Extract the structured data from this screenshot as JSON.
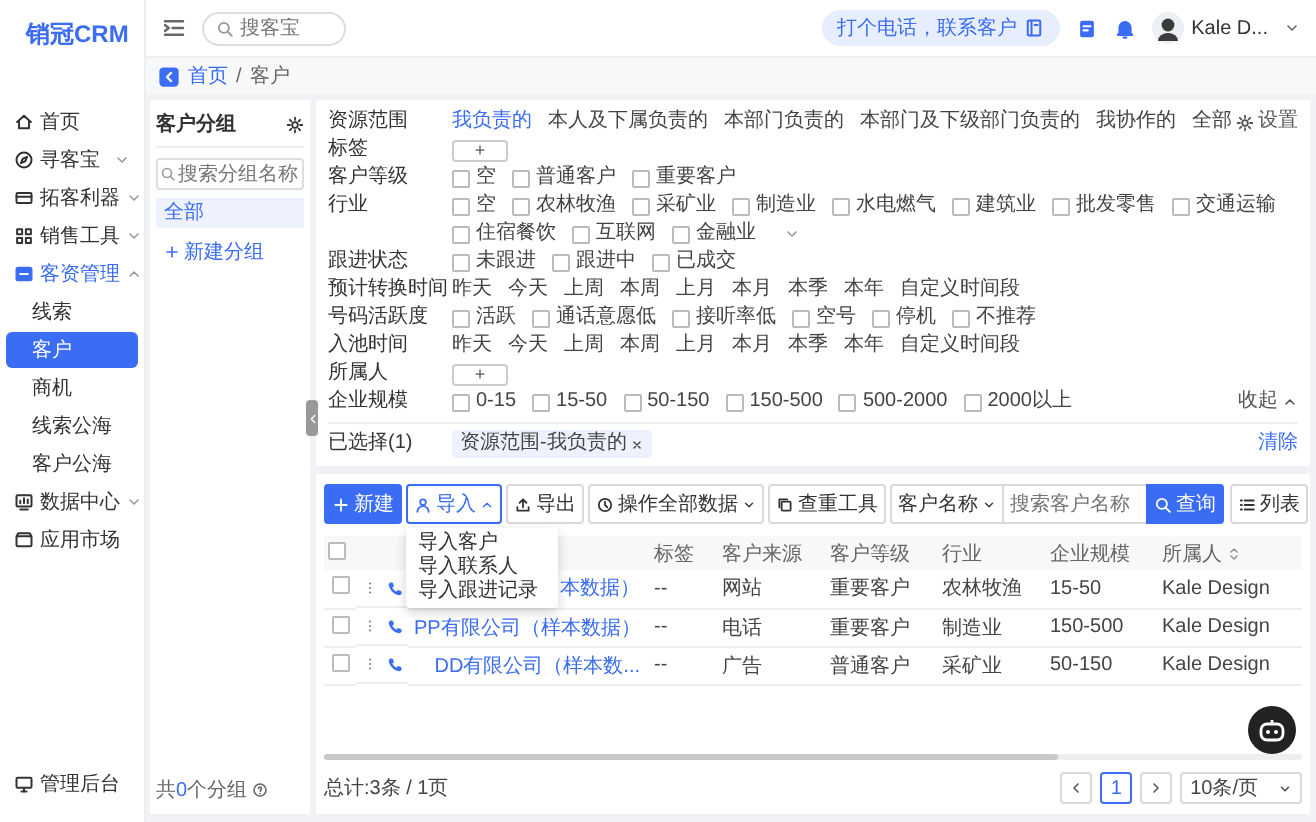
{
  "logo": {
    "text": "销冠CRM"
  },
  "topbar": {
    "search_placeholder": "搜客宝",
    "call_button": "打个电话，联系客户",
    "user": "Kale D..."
  },
  "breadcrumb": {
    "items": [
      "首页",
      "客户"
    ],
    "separator": "/"
  },
  "sidebar": {
    "items": [
      {
        "label": "首页",
        "kind": "link",
        "selected": false
      },
      {
        "label": "寻客宝",
        "kind": "group",
        "expanded": false,
        "selected": false
      },
      {
        "label": "拓客利器",
        "kind": "group",
        "expanded": false,
        "selected": false
      },
      {
        "label": "销售工具",
        "kind": "group",
        "expanded": false,
        "selected": false
      },
      {
        "label": "客资管理",
        "kind": "group",
        "expanded": true,
        "selected": false,
        "children": [
          {
            "label": "线索",
            "selected": false
          },
          {
            "label": "客户",
            "selected": true
          },
          {
            "label": "商机",
            "selected": false
          },
          {
            "label": "线索公海",
            "selected": false
          },
          {
            "label": "客户公海",
            "selected": false
          }
        ]
      },
      {
        "label": "数据中心",
        "kind": "group",
        "expanded": false,
        "selected": false
      },
      {
        "label": "应用市场",
        "kind": "link",
        "selected": false
      }
    ],
    "footer": "管理后台"
  },
  "groups": {
    "title": "客户分组",
    "search_placeholder": "搜索分组名称",
    "items": [
      {
        "label": "全部",
        "selected": true
      }
    ],
    "add_label": "新建分组",
    "count_prefix": "共",
    "count": "0",
    "count_suffix": "个分组"
  },
  "filters": {
    "rows": [
      {
        "label": "资源范围",
        "kind": "links",
        "options": [
          {
            "label": "我负责的",
            "selected": true
          },
          {
            "label": "本人及下属负责的",
            "selected": false
          },
          {
            "label": "本部门负责的",
            "selected": false
          },
          {
            "label": "本部门及下级部门负责的",
            "selected": false
          },
          {
            "label": "我协作的",
            "selected": false
          },
          {
            "label": "全部",
            "selected": false
          }
        ],
        "action": {
          "kind": "settings",
          "label": "设置"
        }
      },
      {
        "label": "标签",
        "kind": "add",
        "button": "+"
      },
      {
        "label": "客户等级",
        "kind": "checks",
        "options": [
          {
            "label": "空",
            "checked": false
          },
          {
            "label": "普通客户",
            "checked": false
          },
          {
            "label": "重要客户",
            "checked": false
          }
        ]
      },
      {
        "label": "行业",
        "kind": "checks",
        "expanded": false,
        "options": [
          {
            "label": "空",
            "checked": false
          },
          {
            "label": "农林牧渔",
            "checked": false
          },
          {
            "label": "采矿业",
            "checked": false
          },
          {
            "label": "制造业",
            "checked": false
          },
          {
            "label": "水电燃气",
            "checked": false
          },
          {
            "label": "建筑业",
            "checked": false
          },
          {
            "label": "批发零售",
            "checked": false
          },
          {
            "label": "交通运输",
            "checked": false
          },
          {
            "label": "住宿餐饮",
            "checked": false
          },
          {
            "label": "互联网",
            "checked": false
          },
          {
            "label": "金融业",
            "checked": false
          }
        ]
      },
      {
        "label": "跟进状态",
        "kind": "checks",
        "options": [
          {
            "label": "未跟进",
            "checked": false
          },
          {
            "label": "跟进中",
            "checked": false
          },
          {
            "label": "已成交",
            "checked": false
          }
        ]
      },
      {
        "label": "预计转换时间",
        "kind": "links",
        "options": [
          {
            "label": "昨天",
            "selected": false
          },
          {
            "label": "今天",
            "selected": false
          },
          {
            "label": "上周",
            "selected": false
          },
          {
            "label": "本周",
            "selected": false
          },
          {
            "label": "上月",
            "selected": false
          },
          {
            "label": "本月",
            "selected": false
          },
          {
            "label": "本季",
            "selected": false
          },
          {
            "label": "本年",
            "selected": false
          },
          {
            "label": "自定义时间段",
            "selected": false
          }
        ]
      },
      {
        "label": "号码活跃度",
        "kind": "checks",
        "options": [
          {
            "label": "活跃",
            "checked": false
          },
          {
            "label": "通话意愿低",
            "checked": false
          },
          {
            "label": "接听率低",
            "checked": false
          },
          {
            "label": "空号",
            "checked": false
          },
          {
            "label": "停机",
            "checked": false
          },
          {
            "label": "不推荐",
            "checked": false
          }
        ]
      },
      {
        "label": "入池时间",
        "kind": "links",
        "options": [
          {
            "label": "昨天",
            "selected": false
          },
          {
            "label": "今天",
            "selected": false
          },
          {
            "label": "上周",
            "selected": false
          },
          {
            "label": "本周",
            "selected": false
          },
          {
            "label": "上月",
            "selected": false
          },
          {
            "label": "本月",
            "selected": false
          },
          {
            "label": "本季",
            "selected": false
          },
          {
            "label": "本年",
            "selected": false
          },
          {
            "label": "自定义时间段",
            "selected": false
          }
        ]
      },
      {
        "label": "所属人",
        "kind": "add",
        "button": "+"
      },
      {
        "label": "企业规模",
        "kind": "checks",
        "options": [
          {
            "label": "0-15",
            "checked": false
          },
          {
            "label": "15-50",
            "checked": false
          },
          {
            "label": "50-150",
            "checked": false
          },
          {
            "label": "150-500",
            "checked": false
          },
          {
            "label": "500-2000",
            "checked": false
          },
          {
            "label": "2000以上",
            "checked": false
          }
        ],
        "action": {
          "kind": "collapse",
          "label": "收起"
        }
      }
    ],
    "selected_label": "已选择(1)",
    "selected_tags": [
      "资源范围-我负责的"
    ],
    "clear_label": "清除"
  },
  "toolbar": {
    "buttons": [
      {
        "label": "新建",
        "kind": "primary"
      },
      {
        "label": "导入",
        "kind": "dropdown",
        "open": true,
        "menu": [
          "导入客户",
          "导入联系人",
          "导入跟进记录"
        ]
      },
      {
        "label": "导出",
        "kind": "plain"
      },
      {
        "label": "操作全部数据",
        "kind": "dropdown",
        "open": false
      },
      {
        "label": "查重工具",
        "kind": "plain"
      }
    ],
    "search": {
      "field": "客户名称",
      "placeholder": "搜索客户名称",
      "button": "查询"
    },
    "view_button": "列表"
  },
  "table": {
    "header_checked": false,
    "columns": [
      {
        "label": "标签",
        "sortable": false
      },
      {
        "label": "客户来源",
        "sortable": false
      },
      {
        "label": "客户等级",
        "sortable": false
      },
      {
        "label": "行业",
        "sortable": false
      },
      {
        "label": "企业规模",
        "sortable": false
      },
      {
        "label": "所属人",
        "sortable": true
      }
    ],
    "rows": [
      {
        "checked": false,
        "name": "本数据）",
        "cells": [
          "--",
          "网站",
          "重要客户",
          "农林牧渔",
          "15-50",
          "Kale Design"
        ]
      },
      {
        "checked": false,
        "name": "PP有限公司（样本数据）",
        "cells": [
          "--",
          "电话",
          "重要客户",
          "制造业",
          "150-500",
          "Kale Design"
        ]
      },
      {
        "checked": false,
        "name": "DD有限公司（样本数...",
        "cells": [
          "--",
          "广告",
          "普通客户",
          "采矿业",
          "50-150",
          "Kale Design"
        ]
      }
    ]
  },
  "pagination": {
    "summary": "总计:3条 / 1页",
    "pages": [
      {
        "label": "1",
        "selected": true
      }
    ],
    "page_size": "10条/页"
  }
}
